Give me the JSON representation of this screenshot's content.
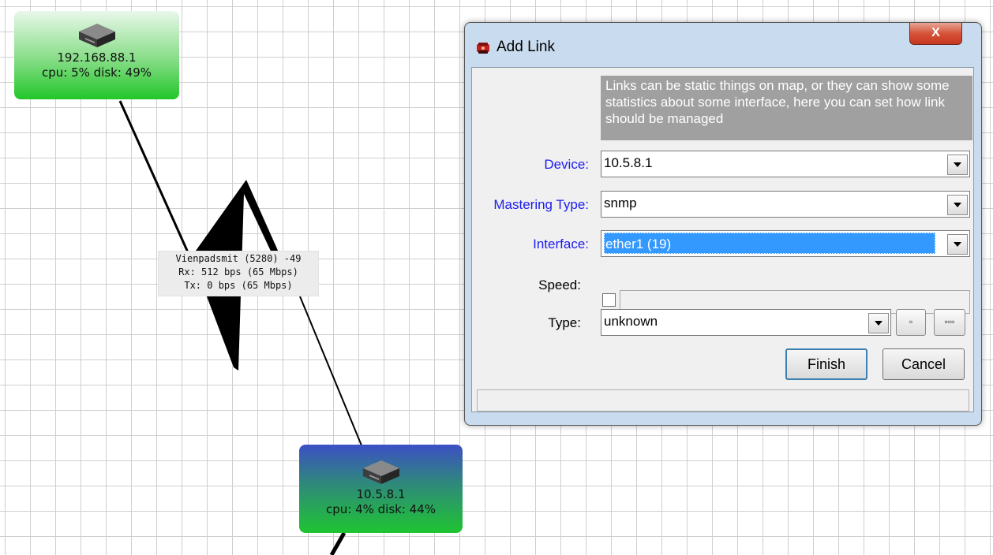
{
  "map": {
    "node_a": {
      "address": "192.168.88.1",
      "stats": "cpu: 5% disk: 49%"
    },
    "node_b": {
      "address": "10.5.8.1",
      "stats": "cpu: 4% disk: 44%"
    },
    "link_label": {
      "line1": "Vienpadsmit (5280) -49",
      "line2": "Rx: 512 bps (65 Mbps)",
      "line3": "Tx: 0 bps (65 Mbps)"
    }
  },
  "dialog": {
    "title": "Add Link",
    "close_glyph": "X",
    "info_text": "Links can be static things on map, or they can show some statistics about some interface, here you can set how link should be managed",
    "device": {
      "label": "Device:",
      "value": "10.5.8.1"
    },
    "mastering_type": {
      "label": "Mastering Type:",
      "value": "snmp"
    },
    "interface": {
      "label": "Interface:",
      "value": "ether1 (19)"
    },
    "speed": {
      "label": "Speed:",
      "checked": false,
      "value": ""
    },
    "type": {
      "label": "Type:",
      "value": "unknown",
      "btn1": "▫",
      "btn2": "▫▫▫"
    },
    "finish_label": "Finish",
    "cancel_label": "Cancel"
  },
  "colors": {
    "field_label_blue": "#1c1cf0",
    "selection_blue": "#3399ff",
    "close_red": "#c7371f"
  }
}
